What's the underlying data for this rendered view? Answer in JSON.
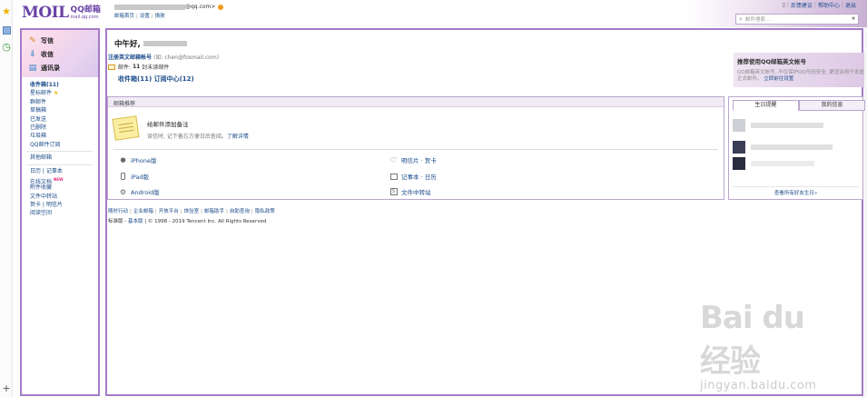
{
  "header": {
    "logo_main": "MOIL",
    "logo_cn": "QQ邮箱",
    "logo_domain": "mail.qq.com",
    "account_suffix": "@qq.com>",
    "links": [
      "邮箱首页",
      "设置",
      "换肤"
    ],
    "top_right": [
      "反馈建议",
      "帮助中心",
      "退出"
    ],
    "search_placeholder": "邮件搜索..."
  },
  "nav": {
    "top": [
      {
        "label": "写信",
        "icon": "pencil-icon"
      },
      {
        "label": "收信",
        "icon": "inbox-icon"
      },
      {
        "label": "通讯录",
        "icon": "contacts-icon"
      }
    ],
    "items": [
      {
        "label": "收件箱(11)",
        "bold": true
      },
      {
        "label": "星标邮件"
      },
      {
        "label": "群邮件"
      },
      {
        "label": "草稿箱"
      },
      {
        "label": "已发送"
      },
      {
        "label": "已删除"
      },
      {
        "label": "垃圾箱"
      },
      {
        "label": "QQ邮件订阅"
      }
    ],
    "other": "其他邮箱",
    "apps": [
      {
        "label": "日历 | 记事本"
      },
      {
        "label": "在线文档",
        "new": "NEW"
      },
      {
        "label": "附件收藏"
      },
      {
        "label": "文件中转站"
      },
      {
        "label": "贺卡 | 明信片"
      },
      {
        "label": "阅读空间"
      }
    ]
  },
  "main": {
    "greeting": "中午好,",
    "register_link": "注册英文邮箱帐号",
    "register_hint": "(如: chen@foxmail.com)",
    "mail_label": "邮件:",
    "mail_count": "11",
    "mail_suffix": "封未读邮件",
    "inbox_link": "收件箱(11)",
    "subscribe_link": "订阅中心(12)"
  },
  "recommend": {
    "title": "推荐使用QQ邮箱英文帐号",
    "desc": "QQ邮箱英文帐号, 不仅保护QQ号码安全, 更适合用于发送正式邮件。",
    "link": "立即前往设置"
  },
  "recommend_box": {
    "title": "邮箱推荐",
    "note_title": "给邮件添加备注",
    "note_desc": "读信时, 记下备忘方便日后查阅。",
    "note_link": "了解详情",
    "apps_left": [
      {
        "label": "iPhone版",
        "icon": "apple-icon"
      },
      {
        "label": "iPad版",
        "icon": "tablet-icon"
      },
      {
        "label": "Android版",
        "icon": "android-icon"
      }
    ],
    "apps_right": [
      {
        "label": "明信片 · 贺卡",
        "icon": "heart-icon"
      },
      {
        "label": "记事本 · 日历",
        "icon": "calendar-icon"
      },
      {
        "label": "文件中转站",
        "icon": "transfer-icon"
      }
    ]
  },
  "birthday": {
    "tabs": [
      "生日提醒",
      "我的信息"
    ],
    "more": "查看所有好友生日»"
  },
  "footer": {
    "links": [
      "随时行动",
      "企业邮箱",
      "开放平台",
      "体验室",
      "邮箱助手",
      "自助查询",
      "隐私政策"
    ],
    "edition_std": "标准版",
    "edition_basic": "基本版",
    "copyright": "© 1998 - 2019 Tencent Inc. All Rights Reserved"
  },
  "watermark": {
    "brand": "Bai du 经验",
    "url": "jingyan.baidu.com"
  },
  "colors": {
    "accent": "#a47bc8",
    "link": "#1a4b8a",
    "logo": "#6a43a6"
  }
}
